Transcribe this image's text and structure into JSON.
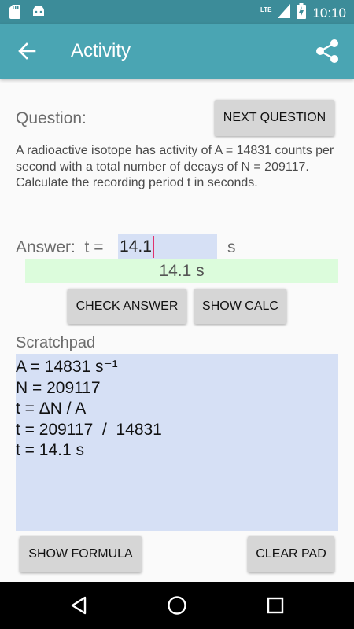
{
  "status_bar": {
    "time": "10:10",
    "network_label": "LTE",
    "icons": [
      "sd-card-icon",
      "android-icon",
      "signal-icon",
      "battery-charging-icon"
    ]
  },
  "app_bar": {
    "title": "Activity",
    "back_icon": "arrow-back-icon",
    "share_icon": "share-icon"
  },
  "question": {
    "label": "Question:",
    "next_button": "NEXT QUESTION",
    "text": "A radioactive isotope has activity of A = 14831 counts per second with a total number of decays of N = 209117. Calculate the recording period t in seconds."
  },
  "answer": {
    "label": "Answer:  t =",
    "value": "14.1",
    "unit": "s",
    "result": "14.1 s"
  },
  "buttons": {
    "check_answer": "CHECK ANSWER",
    "show_calc": "SHOW CALC",
    "show_formula": "SHOW FORMULA",
    "clear_pad": "CLEAR PAD"
  },
  "scratchpad": {
    "label": "Scratchpad",
    "lines": [
      "A = 14831 s⁻¹",
      "N = 209117",
      "t = ΔN / A",
      "t = 209117  /  14831",
      "t = 14.1 s"
    ]
  },
  "nav_bar": {
    "icons": [
      "nav-back-icon",
      "nav-home-icon",
      "nav-recents-icon"
    ]
  },
  "colors": {
    "status_bar": "#3c8c99",
    "app_bar": "#4aa5b3",
    "input_background": "#d6e0f5",
    "result_background": "#dcfcdc",
    "caret": "#e0336e"
  }
}
